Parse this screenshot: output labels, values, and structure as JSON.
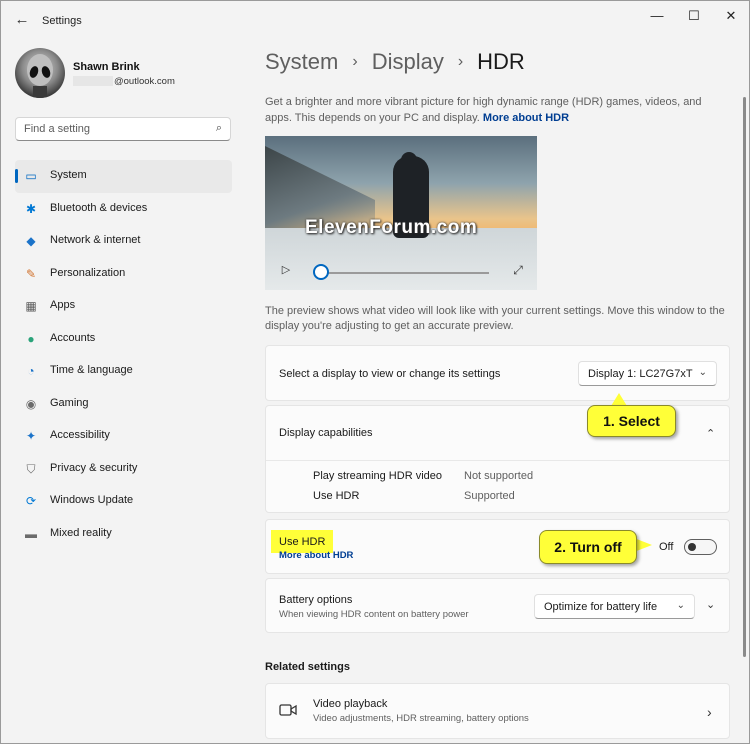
{
  "window": {
    "title": "Settings",
    "back_icon": "back-arrow-icon",
    "controls": {
      "minimize": "—",
      "maximize": "☐",
      "close": "✕"
    }
  },
  "profile": {
    "name": "Shawn Brink",
    "email_domain": "@outlook.com"
  },
  "search": {
    "placeholder": "Find a setting",
    "icon": "⌕"
  },
  "sidebar": {
    "items": [
      {
        "label": "System",
        "icon": "system-display-icon",
        "glyph": "▭",
        "color": "#0067c0",
        "active": true
      },
      {
        "label": "Bluetooth & devices",
        "icon": "bluetooth-icon",
        "glyph": "✱",
        "color": "#0078d4",
        "active": false
      },
      {
        "label": "Network & internet",
        "icon": "wifi-icon",
        "glyph": "◆",
        "color": "#1b73c9",
        "active": false
      },
      {
        "label": "Personalization",
        "icon": "brush-icon",
        "glyph": "✎",
        "color": "#d0702a",
        "active": false
      },
      {
        "label": "Apps",
        "icon": "apps-grid-icon",
        "glyph": "▦",
        "color": "#5a5a5a",
        "active": false
      },
      {
        "label": "Accounts",
        "icon": "person-icon",
        "glyph": "●",
        "color": "#2aa37a",
        "active": false
      },
      {
        "label": "Time & language",
        "icon": "globe-clock-icon",
        "glyph": "◔",
        "color": "#1b73c9",
        "active": false
      },
      {
        "label": "Gaming",
        "icon": "gamepad-icon",
        "glyph": "◉",
        "color": "#6b6b6b",
        "active": false
      },
      {
        "label": "Accessibility",
        "icon": "accessibility-icon",
        "glyph": "✦",
        "color": "#1b73c9",
        "active": false
      },
      {
        "label": "Privacy & security",
        "icon": "shield-icon",
        "glyph": "⛉",
        "color": "#6b6b6b",
        "active": false
      },
      {
        "label": "Windows Update",
        "icon": "update-icon",
        "glyph": "⟳",
        "color": "#0078d4",
        "active": false
      },
      {
        "label": "Mixed reality",
        "icon": "vr-headset-icon",
        "glyph": "▬",
        "color": "#6b6b6b",
        "active": false
      }
    ]
  },
  "breadcrumb": {
    "part1": "System",
    "part2": "Display",
    "current": "HDR",
    "separator": "›"
  },
  "intro": {
    "text": "Get a brighter and more vibrant picture for high dynamic range (HDR) games, videos, and apps. This depends on your PC and display.",
    "link": "More about HDR"
  },
  "video": {
    "watermark": "ElevenForum.com",
    "play_icon": "▷",
    "fullscreen_icon": "⤢"
  },
  "preview_note": "The preview shows what video will look like with your current settings. Move this window to the display you're adjusting to get an accurate preview.",
  "display_select": {
    "label": "Select a display to view or change its settings",
    "value": "Display 1: LC27G7xT",
    "chevron": "⌄"
  },
  "capabilities": {
    "title": "Display capabilities",
    "chevron": "⌃",
    "rows": [
      {
        "label": "Play streaming HDR video",
        "value": "Not supported"
      },
      {
        "label": "Use HDR",
        "value": "Supported"
      }
    ]
  },
  "use_hdr": {
    "label": "Use HDR",
    "link": "More about HDR",
    "state": "Off",
    "on": false
  },
  "battery": {
    "label": "Battery options",
    "sub": "When viewing HDR content on battery power",
    "value": "Optimize for battery life",
    "chevron": "⌄",
    "expand": "⌄"
  },
  "related": {
    "title": "Related settings",
    "video_playback": {
      "label": "Video playback",
      "sub": "Video adjustments, HDR streaming, battery options",
      "icon": "▭",
      "chevron": "›"
    }
  },
  "annotations": {
    "callout1": "1. Select",
    "callout2": "2. Turn off",
    "highlight_color": "#ffff38"
  },
  "colors": {
    "accent": "#0067c0",
    "link": "#003e92"
  }
}
